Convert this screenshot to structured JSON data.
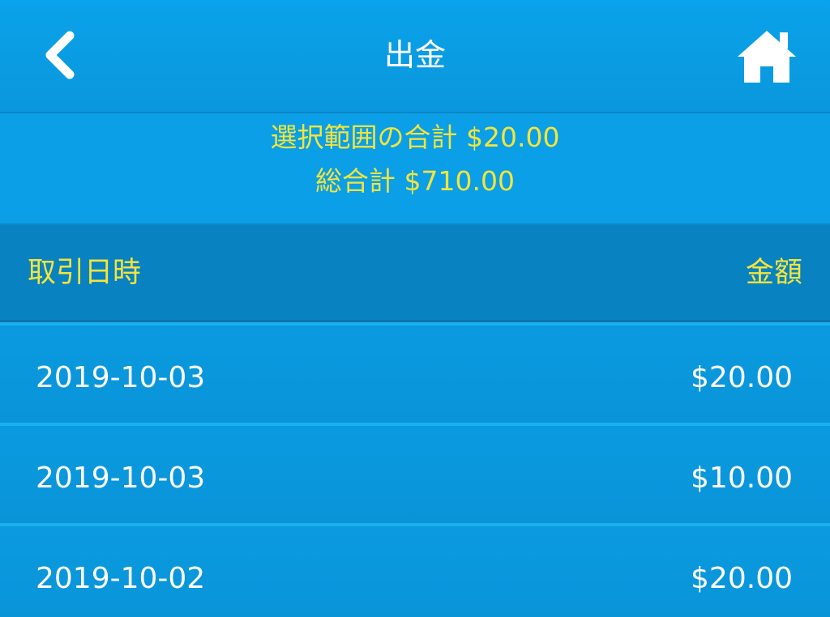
{
  "header": {
    "title": "出金",
    "back_icon": "chevron-left-icon",
    "home_icon": "home-icon"
  },
  "summary": {
    "selected_total": "選択範囲の合計 $20.00",
    "grand_total": "総合計 $710.00"
  },
  "table": {
    "columns": {
      "date": "取引日時",
      "amount": "金額"
    },
    "rows": [
      {
        "date": "2019-10-03",
        "amount": "$20.00"
      },
      {
        "date": "2019-10-03",
        "amount": "$10.00"
      },
      {
        "date": "2019-10-02",
        "amount": "$20.00"
      }
    ]
  },
  "colors": {
    "primary_blue": "#0a9fe6",
    "header_dark_blue": "#0882c0",
    "accent_yellow": "#f5e43c",
    "text_white": "#ffffff"
  }
}
